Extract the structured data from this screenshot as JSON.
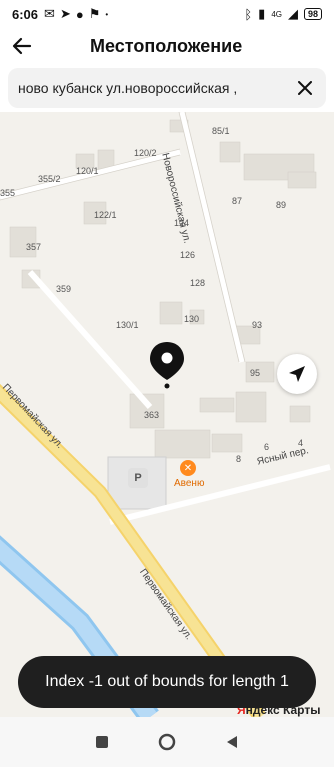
{
  "status": {
    "time": "6:06",
    "network": "4G",
    "battery": "98"
  },
  "header": {
    "title": "Местоположение"
  },
  "search": {
    "value": "ново кубанск ул.новороссийская ,"
  },
  "map": {
    "house_numbers": [
      "85/1",
      "120/2",
      "355/2",
      "120/1",
      "355",
      "87",
      "89",
      "122/1",
      "124",
      "357",
      "126",
      "359",
      "128",
      "130/1",
      "130",
      "93",
      "95",
      "363",
      "8",
      "6",
      "4"
    ],
    "streets": [
      "Новороссийская ул.",
      "Первомайская ул.",
      "Ясный пер.",
      "Первомайская ул."
    ],
    "poi": "Авеню",
    "parking": "P",
    "provider": {
      "prefix": "Я",
      "name": "ндекс Карты"
    }
  },
  "toast": {
    "message": "Index -1 out of bounds for length 1"
  },
  "icons": {
    "back": "arrow-left-icon",
    "clear": "close-icon",
    "locate": "navigation-arrow-icon",
    "pin": "map-pin-icon"
  }
}
